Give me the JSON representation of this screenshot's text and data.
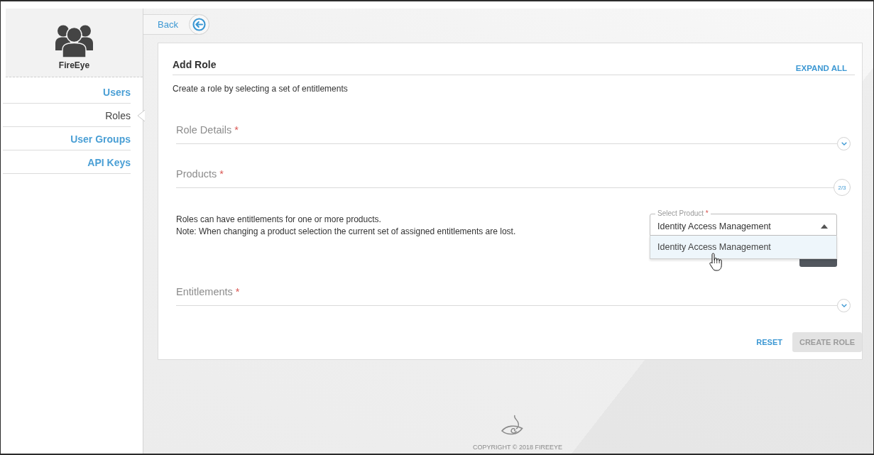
{
  "sidebar": {
    "brand": "FireEye",
    "items": [
      {
        "label": "Users",
        "selected": false
      },
      {
        "label": "Roles",
        "selected": true
      },
      {
        "label": "User Groups",
        "selected": false
      },
      {
        "label": "API Keys",
        "selected": false
      }
    ]
  },
  "back_button": {
    "label": "Back"
  },
  "card": {
    "title": "Add Role",
    "expand_all": "EXPAND ALL",
    "description": "Create a role by selecting a set of entitlements",
    "sections": [
      {
        "title": "Role Details",
        "required_mark": "*",
        "expanded": false
      },
      {
        "title": "Products",
        "required_mark": "*",
        "expanded": true,
        "step": "2/3",
        "notes": [
          "Roles can have entitlements for one or more products.",
          "Note: When changing a product selection the current set of assigned entitlements are lost."
        ],
        "select": {
          "label": "Select Product",
          "required_mark": "*",
          "value": "Identity Access Management",
          "open": true,
          "options": [
            {
              "label": "Identity Access Management",
              "selected": true
            }
          ]
        }
      },
      {
        "title": "Entitlements",
        "required_mark": "*",
        "expanded": false
      }
    ],
    "actions": {
      "reset": "RESET",
      "create": {
        "label": "CREATE ROLE",
        "disabled": true
      }
    }
  },
  "footer": {
    "copyright": "COPYRIGHT © 2018 FIREEYE"
  }
}
